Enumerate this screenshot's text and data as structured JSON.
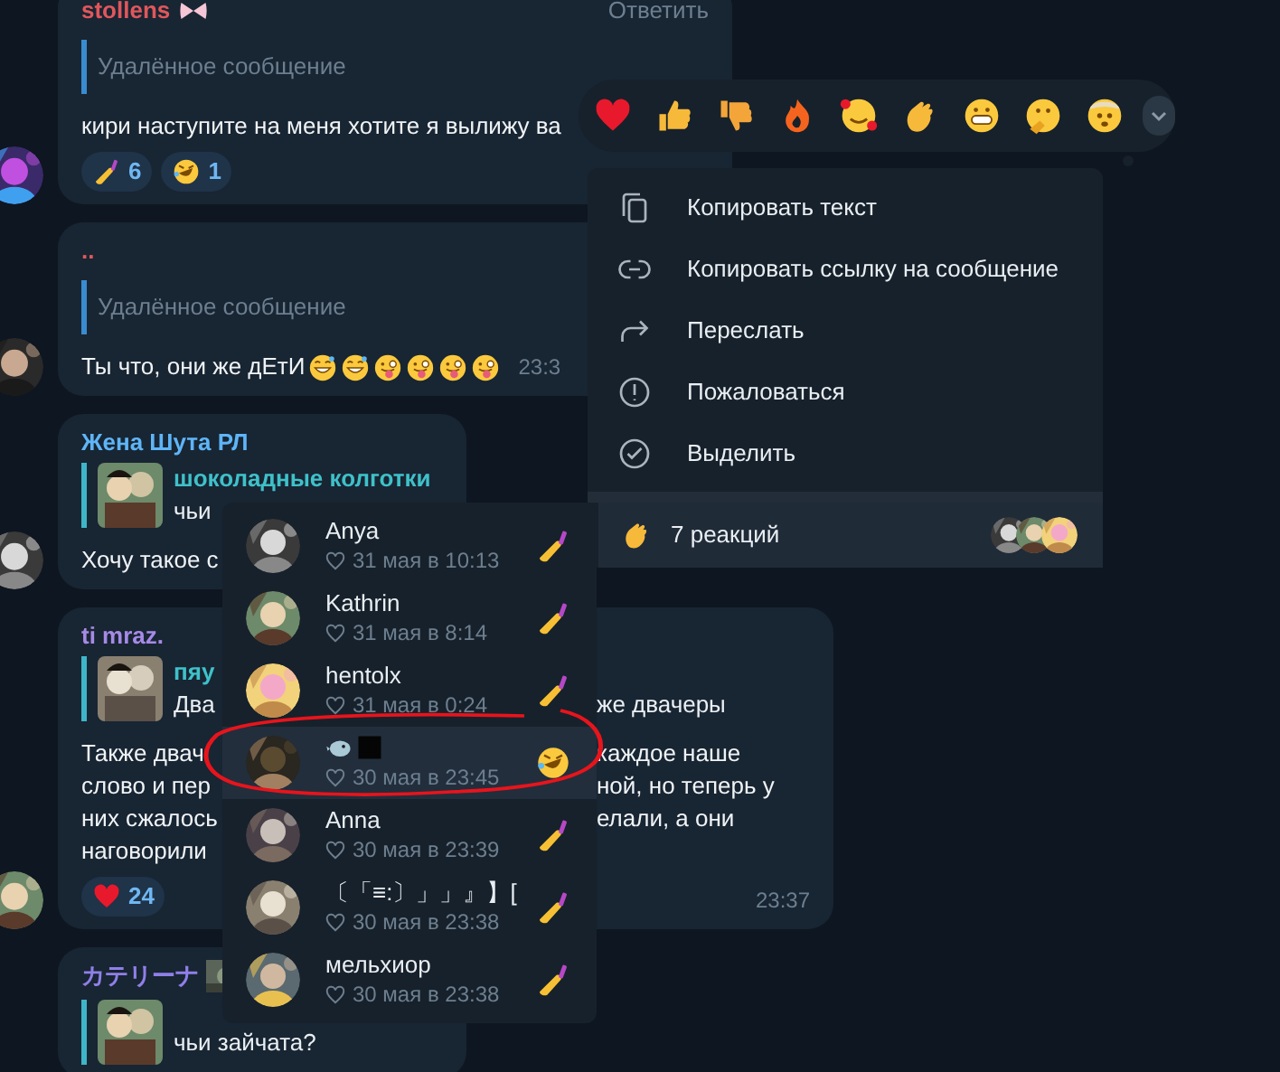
{
  "messages": [
    {
      "author": "stollens",
      "color": "#e0575b",
      "badge": {
        "kind": "bow"
      },
      "reply_button": "Ответить",
      "quote": {
        "text": "Удалённое сообщение"
      },
      "lines": [
        {
          "left": "кири наступите на меня хотите я вылижу ва"
        }
      ],
      "reactions": [
        {
          "kind": "nail-polish",
          "count": "6"
        },
        {
          "kind": "rofl",
          "count": "1"
        }
      ]
    },
    {
      "author": "..",
      "color": "#e0575b",
      "quote": {
        "text": "Удалённое сообщение"
      },
      "lines": [
        {
          "left": "Ты что, они же дЕтИ",
          "emojis": [
            {
              "kind": "sweat-smile"
            },
            {
              "kind": "sweat-smile"
            },
            {
              "kind": "winking-tongue"
            },
            {
              "kind": "winking-tongue"
            },
            {
              "kind": "winking-tongue"
            },
            {
              "kind": "winking-tongue"
            }
          ],
          "time": "23:3"
        }
      ]
    },
    {
      "author": "Жена Шута РЛ",
      "color": "#5eb5f7",
      "quote": {
        "title": "шоколадные колготки",
        "text": "чьи"
      },
      "lines": [
        {
          "left": "Хочу такое с"
        }
      ]
    },
    {
      "author": "ti mraz.",
      "color": "#a68ae6",
      "quote": {
        "title": "пяу",
        "text": "Два",
        "text_right": "же двачеры"
      },
      "lines": [
        {
          "left": "Также двач",
          "right": "каждое наше"
        },
        {
          "left": "слово и пер",
          "right": "ной, но теперь у"
        },
        {
          "left": "них сжалось",
          "right": "елали, а они"
        },
        {
          "left": "наговорили"
        }
      ],
      "reactions": [
        {
          "kind": "heart",
          "count": "24"
        }
      ],
      "time": "23:37"
    },
    {
      "author": "カテリーナ",
      "color": "#8f7fe8",
      "quote": {
        "text": "чьи зайчата?"
      }
    }
  ],
  "reaction_bar": [
    {
      "kind": "heart"
    },
    {
      "kind": "thumbs-up"
    },
    {
      "kind": "thumbs-down"
    },
    {
      "kind": "fire"
    },
    {
      "kind": "smiling-hearts"
    },
    {
      "kind": "clapping"
    },
    {
      "kind": "grinning"
    },
    {
      "kind": "thinking"
    },
    {
      "kind": "exploding-head"
    }
  ],
  "context_menu": {
    "items": [
      {
        "kind": "copy",
        "label": "Копировать текст"
      },
      {
        "kind": "link",
        "label": "Копировать ссылку на сообщение"
      },
      {
        "kind": "forward",
        "label": "Переслать"
      },
      {
        "kind": "report",
        "label": "Пожаловаться"
      },
      {
        "kind": "select",
        "label": "Выделить"
      }
    ],
    "reactions_summary": "7 реакций"
  },
  "reactions_list": [
    {
      "name": "Anya",
      "date": "31 мая в 10:13",
      "reaction": {
        "kind": "nail-polish"
      },
      "selected": false
    },
    {
      "name": "Kathrin",
      "date": "31 мая в 8:14",
      "reaction": {
        "kind": "nail-polish"
      },
      "selected": false
    },
    {
      "name": "hentolx",
      "date": "31 мая в 0:24",
      "reaction": {
        "kind": "nail-polish"
      },
      "selected": false
    },
    {
      "name_icons": [
        {
          "kind": "bird"
        },
        {
          "kind": "square"
        }
      ],
      "date": "30 мая в 23:45",
      "reaction": {
        "kind": "rofl"
      },
      "selected": true
    },
    {
      "name": "Anna",
      "date": "30 мая в 23:39",
      "reaction": {
        "kind": "nail-polish"
      },
      "selected": false
    },
    {
      "name": "〔「≡:〕」」』】[",
      "date": "30 мая в 23:38",
      "reaction": {
        "kind": "nail-polish"
      },
      "selected": false
    },
    {
      "name": "мельхиор",
      "date": "30 мая в 23:38",
      "reaction": {
        "kind": "nail-polish"
      },
      "selected": false
    }
  ]
}
